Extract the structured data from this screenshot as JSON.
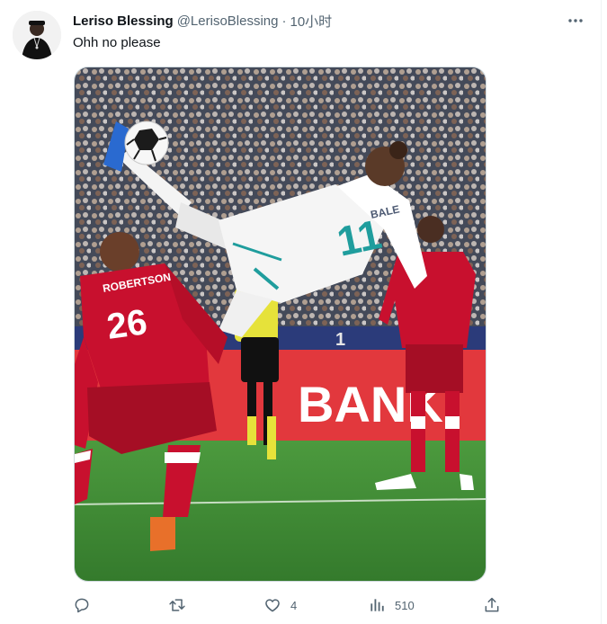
{
  "tweet": {
    "author_name": "Leriso Blessing",
    "author_handle": "@LerisoBlessing",
    "separator": "·",
    "time": "10小时",
    "text": "Ohh no please"
  },
  "media": {
    "jersey_left_name": "ROBERTSON",
    "jersey_left_number": "26",
    "jersey_center_name": "BALE",
    "jersey_center_number": "11",
    "board_text": "BANKI",
    "board_left_digit": "1"
  },
  "actions": {
    "reply_count": "",
    "retweet_count": "",
    "like_count": "4",
    "views_count": "510"
  },
  "colors": {
    "text_primary": "#0f1419",
    "text_secondary": "#536471",
    "liverpool_red": "#c8102e",
    "pitch_green": "#3f8f34"
  },
  "icons": [
    "more-icon",
    "reply-icon",
    "retweet-icon",
    "like-icon",
    "views-icon",
    "share-icon"
  ]
}
